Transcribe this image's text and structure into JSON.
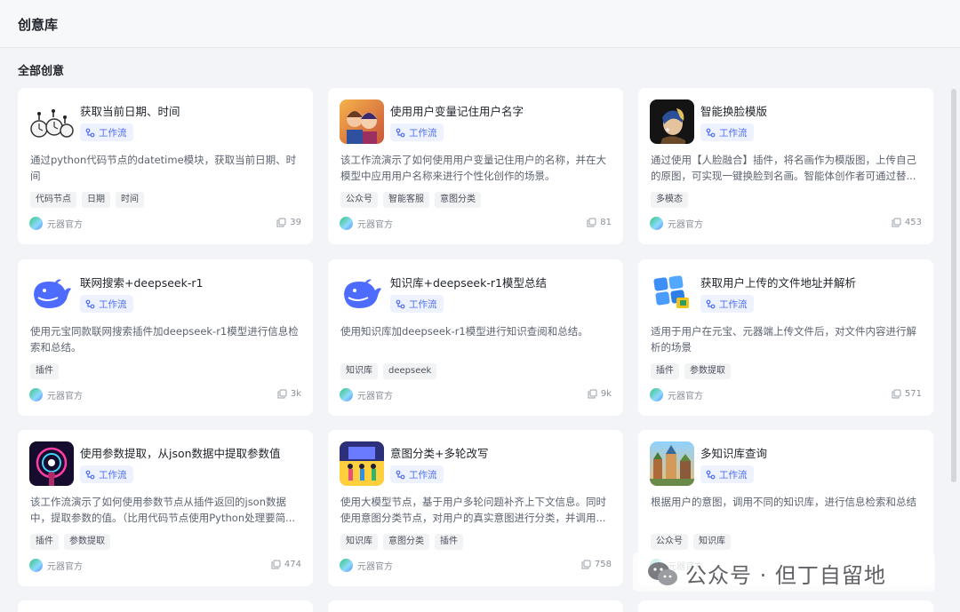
{
  "header": {
    "title": "创意库"
  },
  "section": {
    "title": "全部创意"
  },
  "colors": {
    "accent": "#4e6ef2",
    "tag_bg": "#f2f3f5",
    "card_bg": "#ffffff"
  },
  "cards": [
    {
      "thumb": "clock-running-people",
      "title": "获取当前日期、时间",
      "type": "工作流",
      "desc": "通过python代码节点的datetime模块，获取当前日期、时间",
      "tags": [
        "代码节点",
        "日期",
        "时间"
      ],
      "author": "元器官方",
      "count": "39"
    },
    {
      "thumb": "cartoon-couple",
      "title": "使用用户变量记住用户名字",
      "type": "工作流",
      "desc": "该工作流演示了如何使用用户变量记住用户的名称，并在大模型中应用用户名称来进行个性化创作的场景。",
      "tags": [
        "公众号",
        "智能客服",
        "意图分类"
      ],
      "author": "元器官方",
      "count": "81"
    },
    {
      "thumb": "pearl-earring-portrait",
      "title": "智能换脸模版",
      "type": "工作流",
      "desc": "通过使用【人脸融合】插件，将名画作为模版图，上传自己的原图，可实现一键换脸到名画。智能体创作者可通过替...",
      "tags": [
        "多模态"
      ],
      "author": "元器官方",
      "count": "453"
    },
    {
      "thumb": "deepseek-whale",
      "title": "联网搜索+deepseek-r1",
      "type": "工作流",
      "desc": "使用元宝同款联网搜索插件加deepseek-r1模型进行信息检索和总结。",
      "tags": [
        "插件"
      ],
      "author": "元器官方",
      "count": "3k"
    },
    {
      "thumb": "deepseek-whale",
      "title": "知识库+deepseek-r1模型总结",
      "type": "工作流",
      "desc": "使用知识库加deepseek-r1模型进行知识查阅和总结。",
      "tags": [
        "知识库",
        "deepseek"
      ],
      "author": "元器官方",
      "count": "9k"
    },
    {
      "thumb": "file-tiles",
      "title": "获取用户上传的文件地址并解析",
      "type": "工作流",
      "desc": "适用于用户在元宝、元器端上传文件后，对文件内容进行解析的场景",
      "tags": [
        "插件",
        "参数提取"
      ],
      "author": "元器官方",
      "count": "571"
    },
    {
      "thumb": "neon-portal",
      "title": "使用参数提取，从json数据中提取参数值",
      "type": "工作流",
      "desc": "该工作流演示了如何使用参数节点从插件返回的json数据中，提取参数的值。（比用代码节点使用Python处理要简...",
      "tags": [
        "插件",
        "参数提取"
      ],
      "author": "元器官方",
      "count": "474"
    },
    {
      "thumb": "people-board",
      "title": "意图分类+多轮改写",
      "type": "工作流",
      "desc": "使用大模型节点，基于用户多轮问题补齐上下文信息。同时使用意图分类节点，对用户的真实意图进行分类，并调用...",
      "tags": [
        "知识库",
        "意图分类",
        "插件"
      ],
      "author": "元器官方",
      "count": "758"
    },
    {
      "thumb": "fantasy-town",
      "title": "多知识库查询",
      "type": "工作流",
      "desc": "根据用户的意图，调用不同的知识库，进行信息检索和总结",
      "tags": [
        "公众号",
        "知识库"
      ],
      "author": "元器官方",
      "count": ""
    }
  ],
  "watermark": {
    "text": "公众号 · 但丁自留地"
  }
}
